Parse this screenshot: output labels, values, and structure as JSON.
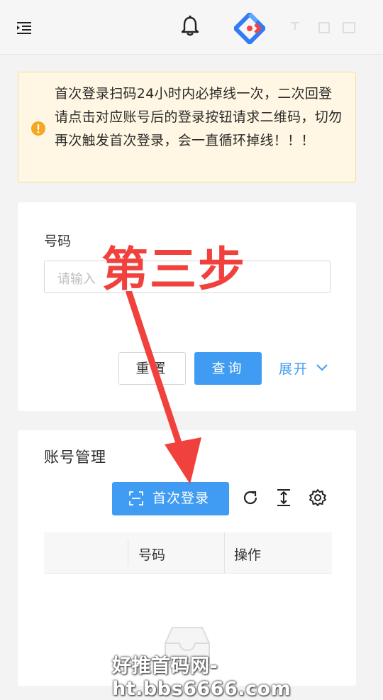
{
  "topbar": {
    "icons": [
      "menu-fold-icon",
      "bell-icon",
      "app-logo-icon"
    ]
  },
  "notice": {
    "icon": "exclamation-circle-icon",
    "text": "首次登录扫码24小时内必掉线一次，二次回登请点击对应账号后的登录按钮请求二维码，切勿再次触发首次登录，会一直循环掉线！！！"
  },
  "search": {
    "field_label": "号码",
    "placeholder": "请输入",
    "reset_label": "重置",
    "query_label": "查询",
    "expand_label": "展开"
  },
  "accounts": {
    "title": "账号管理",
    "first_login_label": "首次登录",
    "columns": [
      "号码",
      "操作"
    ]
  },
  "overlay": {
    "step_text": "第三步",
    "watermark": "好推首码网-ht.bbs6666.com"
  },
  "colors": {
    "primary": "#3f9cf2",
    "warning": "#f5a623",
    "annotation": "#f0413d",
    "logo_blue": "#2f7cf6",
    "logo_red": "#ef4545"
  }
}
